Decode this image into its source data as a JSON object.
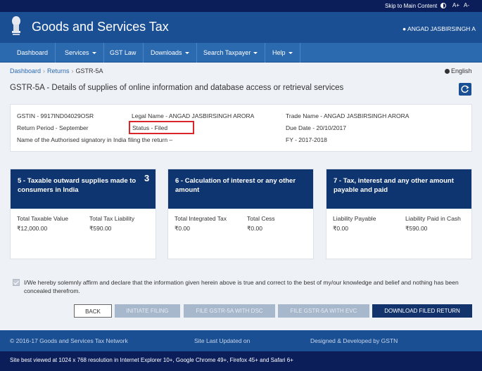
{
  "topbar": {
    "skip_link": "Skip to Main Content",
    "font_increase": "A+",
    "font_decrease": "A-"
  },
  "header": {
    "title": "Goods and Services Tax",
    "user": "ANGAD JASBIRSINGH A"
  },
  "nav": {
    "items": [
      {
        "label": "Dashboard",
        "dropdown": false
      },
      {
        "label": "Services",
        "dropdown": true
      },
      {
        "label": "GST Law",
        "dropdown": false
      },
      {
        "label": "Downloads",
        "dropdown": true
      },
      {
        "label": "Search Taxpayer",
        "dropdown": true
      },
      {
        "label": "Help",
        "dropdown": true
      }
    ]
  },
  "breadcrumb": {
    "items": [
      "Dashboard",
      "Returns",
      "GSTR-5A"
    ]
  },
  "language": "English",
  "page_title": "GSTR-5A - Details of supplies of online information and database access or retrieval services",
  "info": {
    "gstin": "GSTIN - 9917IND04029OSR",
    "legal_name": "Legal Name - ANGAD JASBIRSINGH ARORA",
    "trade_name": "Trade Name - ANGAD JASBIRSINGH ARORA",
    "return_period": "Return Period - September",
    "status": "Status - Filed",
    "due_date": "Due Date - 20/10/2017",
    "signatory": "Name of the Authorised signatory in India filing the return –",
    "fy": "FY - 2017-2018"
  },
  "cards": [
    {
      "title": "5 - Taxable outward supplies made to consumers in India",
      "superscript": "3",
      "fields": [
        {
          "label": "Total Taxable Value",
          "value": "₹12,000.00"
        },
        {
          "label": "Total Tax Liability",
          "value": "₹590.00"
        }
      ]
    },
    {
      "title": "6 - Calculation of interest or any other amount",
      "superscript": "",
      "fields": [
        {
          "label": "Total Integrated Tax",
          "value": "₹0.00"
        },
        {
          "label": "Total Cess",
          "value": "₹0.00"
        }
      ]
    },
    {
      "title": "7 - Tax, interest and any other amount payable and paid",
      "superscript": "",
      "fields": [
        {
          "label": "Liability Payable",
          "value": "₹0.00"
        },
        {
          "label": "Liability Paid in Cash",
          "value": "₹590.00"
        }
      ]
    }
  ],
  "declaration": "I/We hereby solemnly affirm and declare that the information given herein above is true and correct to the best of my/our knowledge and belief and nothing has been concealed therefrom.",
  "buttons": {
    "back": "BACK",
    "initiate_filing": "INITIATE FILING",
    "file_dsc": "FILE GSTR-5A WITH DSC",
    "file_evc": "FILE GSTR-5A WITH EVC",
    "download": "DOWNLOAD FILED RETURN"
  },
  "footer": {
    "copyright": "© 2016-17 Goods and Services Tax Network",
    "updated": "Site Last Updated on",
    "developed": "Designed & Developed by GSTN",
    "browser_note": "Site best viewed at 1024 x 768 resolution in Internet Explorer 10+, Google Chrome 49+, Firefox 45+ and Safari 6+"
  },
  "colors": {
    "header": "#1b4f93",
    "nav": "#2c6ab0",
    "card_head": "#0f3570",
    "status_highlight": "#d9262b"
  }
}
